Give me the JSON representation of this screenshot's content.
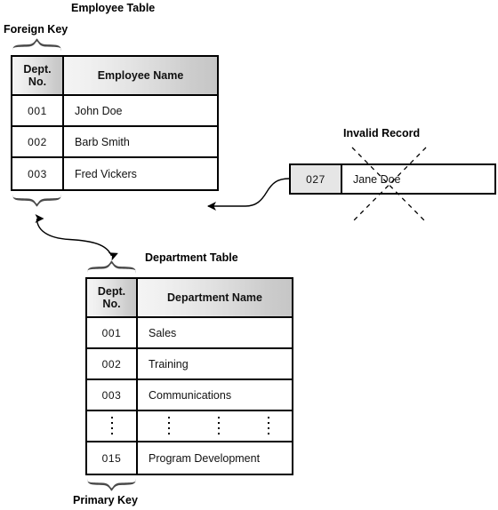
{
  "labels": {
    "employee_table": "Employee Table",
    "foreign_key": "Foreign Key",
    "invalid_record": "Invalid Record",
    "department_table": "Department Table",
    "primary_key": "Primary Key"
  },
  "employee_table": {
    "headers": {
      "key_line1": "Dept.",
      "key_line2": "No.",
      "name": "Employee Name"
    },
    "rows": [
      {
        "dept_no": "001",
        "name": "John Doe"
      },
      {
        "dept_no": "002",
        "name": "Barb Smith"
      },
      {
        "dept_no": "003",
        "name": "Fred Vickers"
      }
    ]
  },
  "invalid_record": {
    "dept_no": "027",
    "name": "Jane Doe",
    "crossed_out": "true"
  },
  "department_table": {
    "headers": {
      "key_line1": "Dept.",
      "key_line2": "No.",
      "name": "Department Name"
    },
    "rows": [
      {
        "dept_no": "001",
        "name": "Sales"
      },
      {
        "dept_no": "002",
        "name": "Training"
      },
      {
        "dept_no": "003",
        "name": "Communications"
      },
      {
        "dept_no": "",
        "name": "",
        "ellipsis": "true"
      },
      {
        "dept_no": "015",
        "name": "Program Development"
      }
    ]
  },
  "colors": {
    "brace": "#4a4a4a",
    "line": "#000000",
    "header_gradient_start": "#f4f4f4",
    "header_gradient_end": "#c6c6c6",
    "invalid_key_fill": "#e6e6e6",
    "background": "#ffffff"
  }
}
